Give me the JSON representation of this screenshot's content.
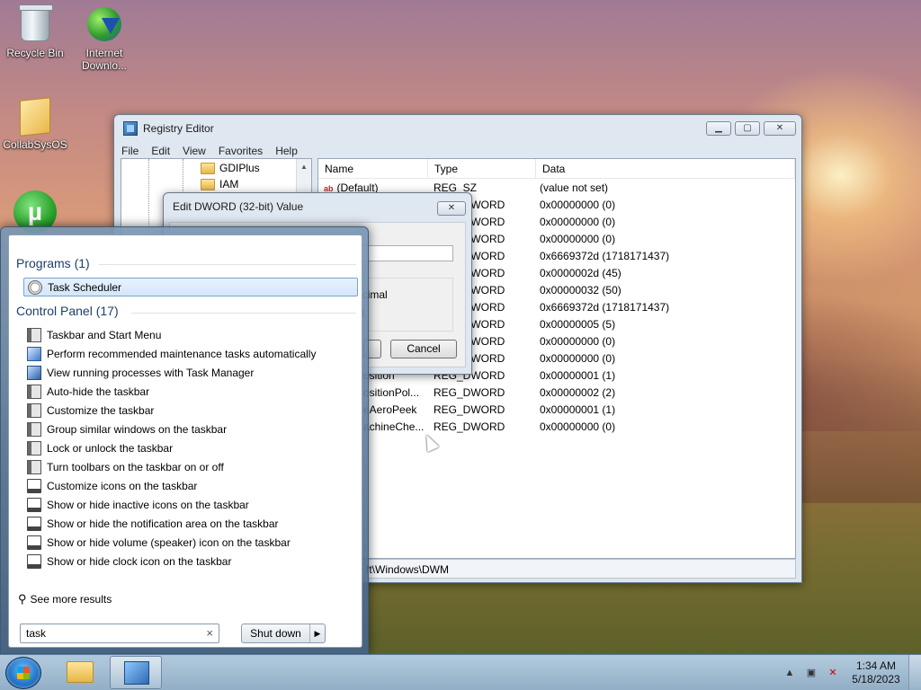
{
  "desktop": {
    "icons": [
      {
        "label": "Recycle Bin"
      },
      {
        "label": "Internet Downlo..."
      },
      {
        "label": "CollabSysOS"
      },
      {
        "label": "µTorrent"
      }
    ]
  },
  "regedit": {
    "title": "Registry Editor",
    "menu": [
      "File",
      "Edit",
      "View",
      "Favorites",
      "Help"
    ],
    "tree": [
      "GDIPlus",
      "IAM"
    ],
    "columns": [
      "Name",
      "Type",
      "Data"
    ],
    "rows": [
      {
        "name": "(Default)",
        "type": "REG_SZ",
        "data": "(value not set)"
      },
      {
        "name": "",
        "type": "REG_DWORD",
        "data": "0x00000000 (0)"
      },
      {
        "name": "",
        "type": "REG_DWORD",
        "data": "0x00000000 (0)"
      },
      {
        "name": "",
        "type": "REG_DWORD",
        "data": "0x00000000 (0)"
      },
      {
        "name": "",
        "type": "REG_DWORD",
        "data": "0x6669372d (1718171437)"
      },
      {
        "name": "",
        "type": "REG_DWORD",
        "data": "0x0000002d (45)"
      },
      {
        "name": "",
        "type": "REG_DWORD",
        "data": "0x00000032 (50)"
      },
      {
        "name": "",
        "type": "REG_DWORD",
        "data": "0x6669372d (1718171437)"
      },
      {
        "name": "",
        "type": "REG_DWORD",
        "data": "0x00000005 (5)"
      },
      {
        "name": "",
        "type": "REG_DWORD",
        "data": "0x00000000 (0)"
      },
      {
        "name": "",
        "type": "REG_DWORD",
        "data": "0x00000000 (0)"
      },
      {
        "name": "osition",
        "type": "REG_DWORD",
        "data": "0x00000001 (1)"
      },
      {
        "name": "ositionPol...",
        "type": "REG_DWORD",
        "data": "0x00000002 (2)"
      },
      {
        "name": "eAeroPeek",
        "type": "REG_DWORD",
        "data": "0x00000001 (1)"
      },
      {
        "name": "achineChe...",
        "type": "REG_DWORD",
        "data": "0x00000000 (0)"
      }
    ],
    "status": "ft\\Windows\\DWM"
  },
  "dialog": {
    "title": "Edit DWORD (32-bit) Value",
    "radio1": "ecimal",
    "radio2": "al",
    "cancel": "Cancel"
  },
  "startmenu": {
    "programs_heading": "Programs (1)",
    "programs": [
      {
        "label": "Task Scheduler",
        "icon": "clock-icon"
      }
    ],
    "control_heading": "Control Panel (17)",
    "control": [
      {
        "label": "Taskbar and Start Menu",
        "icon": "taskbar-icon"
      },
      {
        "label": "Perform recommended maintenance tasks automatically",
        "icon": "maintenance-icon"
      },
      {
        "label": "View running processes with Task Manager",
        "icon": "task-manager-icon"
      },
      {
        "label": "Auto-hide the taskbar",
        "icon": "taskbar-icon"
      },
      {
        "label": "Customize the taskbar",
        "icon": "taskbar-icon"
      },
      {
        "label": "Group similar windows on the taskbar",
        "icon": "taskbar-icon"
      },
      {
        "label": "Lock or unlock the taskbar",
        "icon": "taskbar-icon"
      },
      {
        "label": "Turn toolbars on the taskbar on or off",
        "icon": "taskbar-icon"
      },
      {
        "label": "Customize icons on the taskbar",
        "icon": "monitor-icon"
      },
      {
        "label": "Show or hide inactive icons on the taskbar",
        "icon": "monitor-icon"
      },
      {
        "label": "Show or hide the notification area on the taskbar",
        "icon": "monitor-icon"
      },
      {
        "label": "Show or hide volume (speaker) icon on the taskbar",
        "icon": "monitor-icon"
      },
      {
        "label": "Show or hide clock icon on the taskbar",
        "icon": "monitor-icon"
      }
    ],
    "see_more": "See more results",
    "search_value": "task",
    "clear": "×",
    "shutdown": "Shut down",
    "shutdown_arrow": "▶"
  },
  "taskbar": {
    "time": "1:34 AM",
    "date": "5/18/2023"
  }
}
